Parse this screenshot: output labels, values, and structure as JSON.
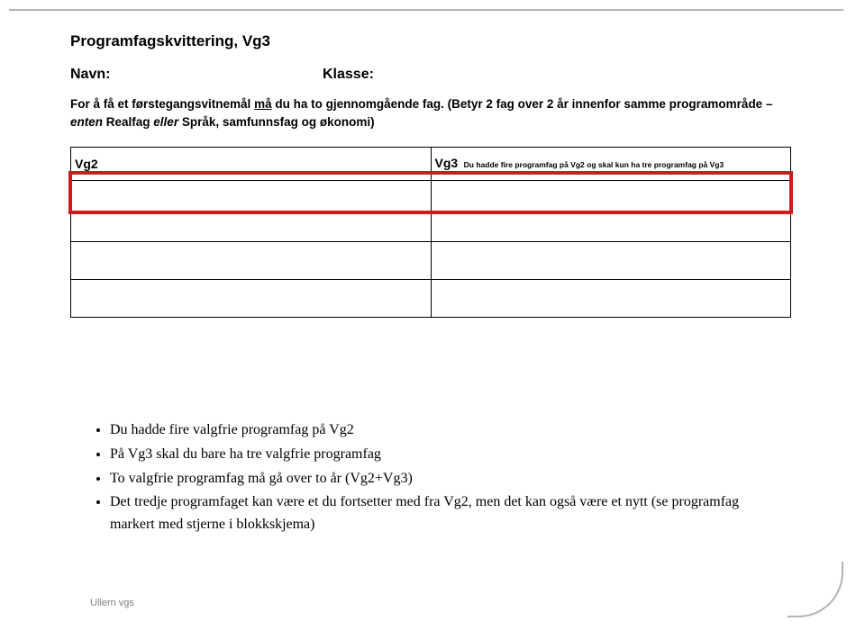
{
  "form": {
    "title": "Programfagskvittering, Vg3",
    "fields": {
      "navn_label": "Navn:",
      "klasse_label": "Klasse:"
    },
    "instruction": {
      "pre": "For å få et førstegangsvitnemål ",
      "underlined": "må",
      "post1": " du ha to gjennomgående fag. (Betyr 2 fag over 2 år innenfor samme programområde – ",
      "realfag_pre_italic": "enten ",
      "realfag": "Realfag",
      "eller": " eller ",
      "omrade2": "Språk, samfunnsfag og økonomi)"
    },
    "table": {
      "vg2_label": "Vg2",
      "vg3_label": "Vg3",
      "vg3_note": "Du hadde fire programfag på Vg2 og skal kun ha tre programfag på Vg3"
    }
  },
  "bullets": {
    "b1": "Du hadde fire valgfrie programfag på Vg2",
    "b2": "På Vg3 skal du bare ha tre valgfrie programfag",
    "b3": "To valgfrie programfag må gå over to år (Vg2+Vg3)",
    "b4": "Det tredje programfaget kan være et du fortsetter med fra Vg2, men det kan også være et nytt (se programfag markert med stjerne i blokkskjema)"
  },
  "footer": "Ullern vgs"
}
